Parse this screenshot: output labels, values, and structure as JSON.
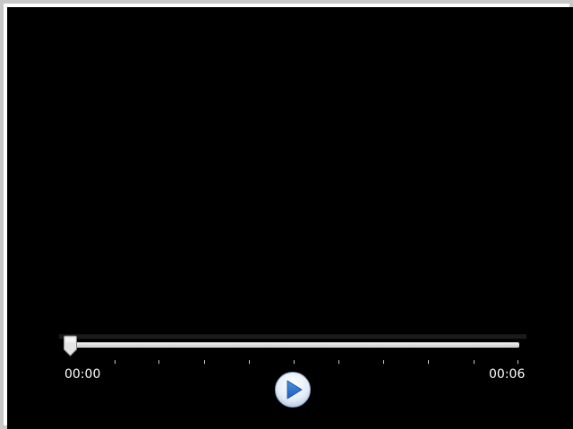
{
  "player": {
    "state": "paused",
    "progress": 0,
    "current_time": "00:00",
    "total_time": "00:06",
    "play_button_icon": "play-icon",
    "accent_color": "#2a6fc4"
  }
}
